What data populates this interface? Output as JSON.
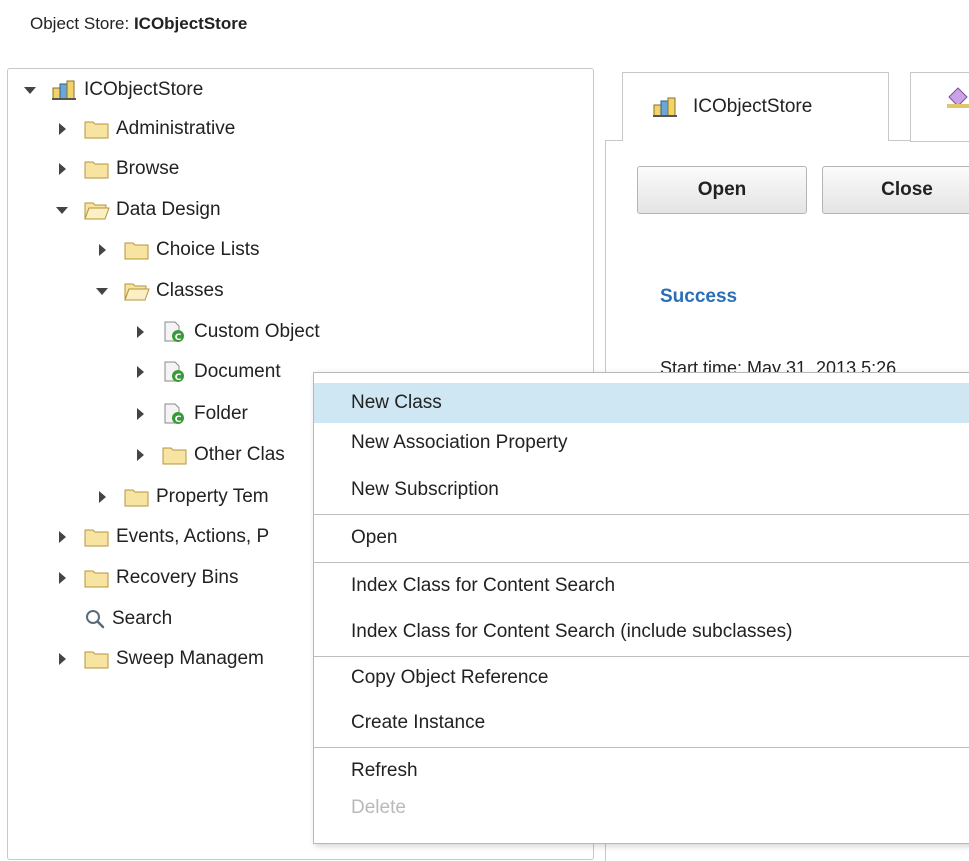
{
  "header": {
    "prefix": "Object Store: ",
    "store_name": "ICObjectStore"
  },
  "tree": [
    {
      "label": "ICObjectStore",
      "icon": "object-store-icon",
      "twisty": "expanded"
    },
    {
      "label": "Administrative",
      "icon": "folder-icon",
      "twisty": "collapsed"
    },
    {
      "label": "Browse",
      "icon": "folder-icon",
      "twisty": "collapsed"
    },
    {
      "label": "Data Design",
      "icon": "folder-open-icon",
      "twisty": "expanded"
    },
    {
      "label": "Choice Lists",
      "icon": "folder-icon",
      "twisty": "collapsed"
    },
    {
      "label": "Classes",
      "icon": "folder-open-icon",
      "twisty": "expanded"
    },
    {
      "label": "Custom Object",
      "icon": "class-icon",
      "twisty": "collapsed"
    },
    {
      "label": "Document",
      "icon": "class-icon",
      "twisty": "collapsed"
    },
    {
      "label": "Folder",
      "icon": "class-icon",
      "twisty": "collapsed"
    },
    {
      "label": "Other Clas",
      "icon": "folder-icon",
      "twisty": "collapsed"
    },
    {
      "label": "Property Tem",
      "icon": "folder-icon",
      "twisty": "collapsed"
    },
    {
      "label": "Events, Actions, P",
      "icon": "folder-icon",
      "twisty": "collapsed"
    },
    {
      "label": "Recovery Bins",
      "icon": "folder-icon",
      "twisty": "collapsed"
    },
    {
      "label": "Search",
      "icon": "search-icon",
      "twisty": "none"
    },
    {
      "label": "Sweep Managem",
      "icon": "folder-icon",
      "twisty": "collapsed"
    }
  ],
  "tabs": {
    "active_label": "ICObjectStore"
  },
  "buttons": {
    "open": "Open",
    "close": "Close"
  },
  "status": {
    "title": "Success",
    "start_time": "Start time: May 31, 2013 5:26"
  },
  "menu": [
    {
      "label": "New Class",
      "highlight": true
    },
    {
      "label": "New Association Property"
    },
    {
      "label": "New Subscription"
    },
    {
      "label": "Open"
    },
    {
      "label": "Index Class for Content Search"
    },
    {
      "label": "Index Class for Content Search (include subclasses)"
    },
    {
      "label": "Copy Object Reference"
    },
    {
      "label": "Create Instance"
    },
    {
      "label": "Refresh"
    },
    {
      "label": "Delete",
      "disabled": true
    }
  ],
  "colors": {
    "accent": "#2a6fb5",
    "menu_highlight": "#cfe7f3",
    "folder": "#f6e4a0",
    "class_badge": "#3a9a3a"
  }
}
